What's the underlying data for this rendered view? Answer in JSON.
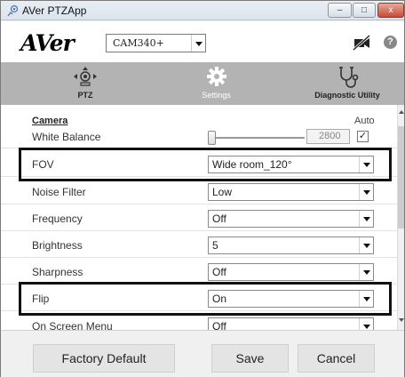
{
  "window": {
    "title": "AVer PTZApp",
    "minimize_label": "–",
    "maximize_label": "□",
    "close_label": "x"
  },
  "header": {
    "logo_text": "AVer",
    "model_select_value": "CAM340+"
  },
  "tabs": [
    {
      "label": "PTZ",
      "icon": "ptz-camera-icon"
    },
    {
      "label": "Settings",
      "icon": "gear-icon",
      "active": true
    },
    {
      "label": "Diagnostic Utility",
      "icon": "stethoscope-icon"
    }
  ],
  "camera": {
    "heading": "Camera",
    "auto_label": "Auto",
    "white_balance": {
      "label": "White Balance",
      "value": "2800",
      "auto_checked": true,
      "checkmark": "✓"
    }
  },
  "settings": [
    {
      "label": "FOV",
      "value": "Wide room_120°",
      "highlighted": true
    },
    {
      "label": "Noise Filter",
      "value": "Low"
    },
    {
      "label": "Frequency",
      "value": "Off"
    },
    {
      "label": "Brightness",
      "value": "5"
    },
    {
      "label": "Sharpness",
      "value": "Off"
    },
    {
      "label": "Flip",
      "value": "On",
      "highlighted": true
    },
    {
      "label": "On Screen Menu",
      "value": "Off"
    }
  ],
  "footer": {
    "factory_default": "Factory Default",
    "save": "Save",
    "cancel": "Cancel"
  },
  "colors": {
    "tab_bar": "#b3b3b3",
    "highlight_border": "#111111",
    "panel_bg": "#ffffff"
  }
}
